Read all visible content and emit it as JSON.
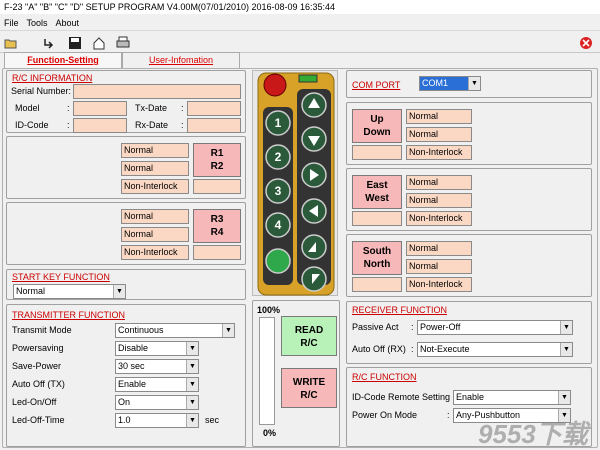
{
  "title": "F-23 \"A\" \"B\" \"C\" \"D\" SETUP PROGRAM V4.00M(07/01/2010)  2016-08-09  16:35:44",
  "menu": [
    "File",
    "Tools",
    "About"
  ],
  "tabs": {
    "function_setting": "Function-Setting",
    "user_information": "User-Infomation"
  },
  "rc_info": {
    "heading": "R/C INFORMATION",
    "serial_label": "Serial Number:",
    "model_label": "Model",
    "id_code_label": "ID-Code",
    "tx_date_label": "Tx-Date",
    "rx_date_label": "Rx-Date",
    "colon": ":"
  },
  "relay1": {
    "a": "Normal",
    "b": "Normal",
    "c": "Non-Interlock",
    "button": "R1\nR2"
  },
  "relay2": {
    "a": "Normal",
    "b": "Normal",
    "c": "Non-Interlock",
    "button": "R3\nR4"
  },
  "start_key": {
    "heading": "START KEY FUNCTION",
    "value": "Normal"
  },
  "transmitter": {
    "heading": "TRANSMITTER FUNCTION",
    "rows": [
      {
        "label": "Transmit Mode",
        "value": "Continuous"
      },
      {
        "label": "Powersaving",
        "value": "Disable"
      },
      {
        "label": "Save-Power",
        "value": "30 sec"
      },
      {
        "label": "Auto Off (TX)",
        "value": "Enable"
      },
      {
        "label": "Led-On/Off",
        "value": "On"
      },
      {
        "label": "Led-Off-Time",
        "value": "1.0"
      }
    ],
    "unit": "sec"
  },
  "progress": {
    "top": "100%",
    "bottom": "0%",
    "value": 0
  },
  "read_button": "READ\nR/C",
  "write_button": "WRITE\nR/C",
  "com_port": {
    "label": "COM  PORT",
    "value": "COM1"
  },
  "direction_groups": [
    {
      "button": "Up\nDown",
      "a": "Normal",
      "b": "Normal",
      "c": "Non-Interlock"
    },
    {
      "button": "East\nWest",
      "a": "Normal",
      "b": "Normal",
      "c": "Non-Interlock"
    },
    {
      "button": "South\nNorth",
      "a": "Normal",
      "b": "Normal",
      "c": "Non-Interlock"
    }
  ],
  "receiver": {
    "heading": "RECEIVER  FUNCTION",
    "rows": [
      {
        "label": "Passive Act",
        "colon": ":",
        "value": "Power-Off"
      },
      {
        "label": "Auto Off (RX)",
        "colon": ":",
        "value": "Not-Execute"
      }
    ]
  },
  "rc_function": {
    "heading": "R/C  FUNCTION",
    "rows": [
      {
        "label": "ID-Code Remote Setting",
        "value": "Enable"
      },
      {
        "label": "Power On Mode",
        "colon": ":",
        "value": "Any-Pushbutton"
      }
    ]
  },
  "remote_keys": [
    "1",
    "2",
    "3",
    "4"
  ],
  "watermark": "9553下载",
  "colors": {
    "field": "#fbd8c4",
    "button_pink": "#f6b8b8",
    "button_green": "#b9f2b9",
    "heading_red": "#cc0000",
    "remote_body": "#d8a228"
  },
  "icons": [
    "open-icon",
    "arrow-icon",
    "save-icon",
    "home-icon",
    "print-icon",
    "close-icon"
  ]
}
